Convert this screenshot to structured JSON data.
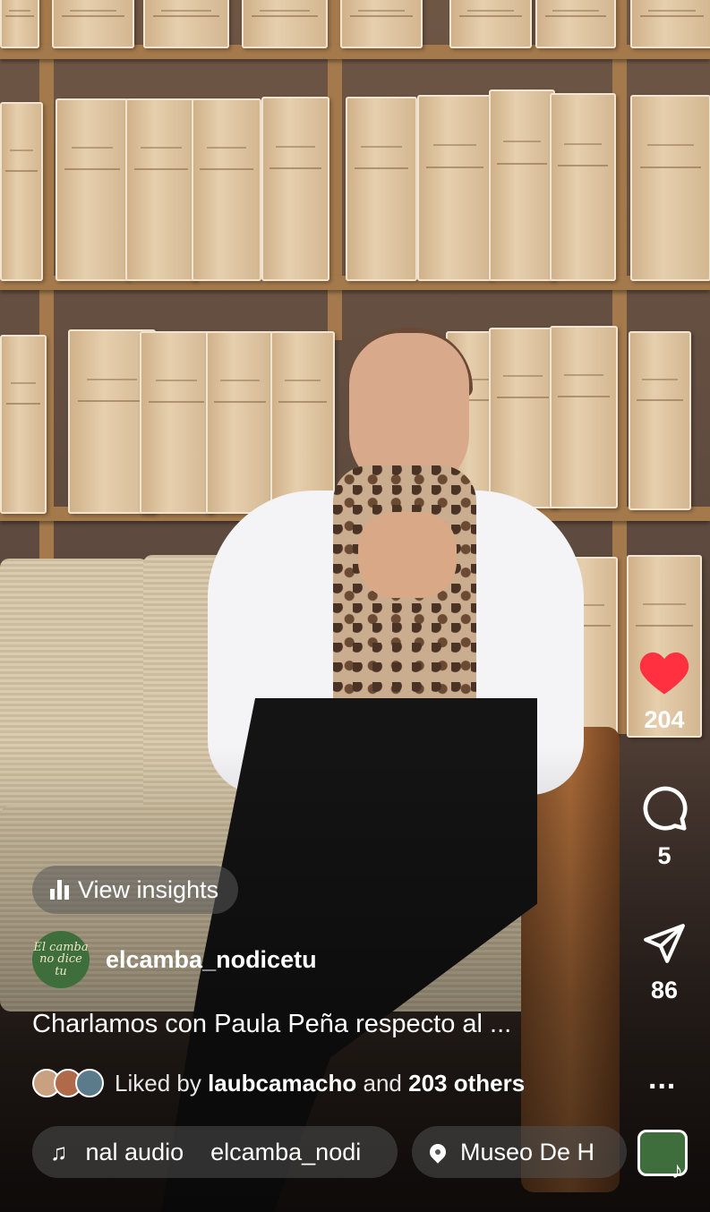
{
  "insights": {
    "label": "View insights",
    "icon": "bar-chart-icon"
  },
  "author": {
    "username": "elcamba_nodicetu",
    "avatar_text": "El camba no dice tu"
  },
  "caption": {
    "text": "Charlamos con Paula Peña respecto al ..."
  },
  "likes": {
    "prefix": "Liked by",
    "user": "laubcamacho",
    "joiner": "and",
    "others": "203 others"
  },
  "audio": {
    "icon": "music-note-icon",
    "part1": "nal audio",
    "part2": "elcamba_nodi"
  },
  "location": {
    "icon": "location-pin-icon",
    "text": "Museo De H"
  },
  "actions": {
    "like": {
      "icon": "heart-icon",
      "count": "204",
      "color": "#ff3040"
    },
    "comment": {
      "icon": "comment-icon",
      "count": "5"
    },
    "share": {
      "icon": "send-icon",
      "count": "86"
    },
    "more": {
      "icon": "more-icon",
      "label": "..."
    },
    "audio_thumb": {
      "icon": "audio-thumbnail-icon"
    }
  }
}
